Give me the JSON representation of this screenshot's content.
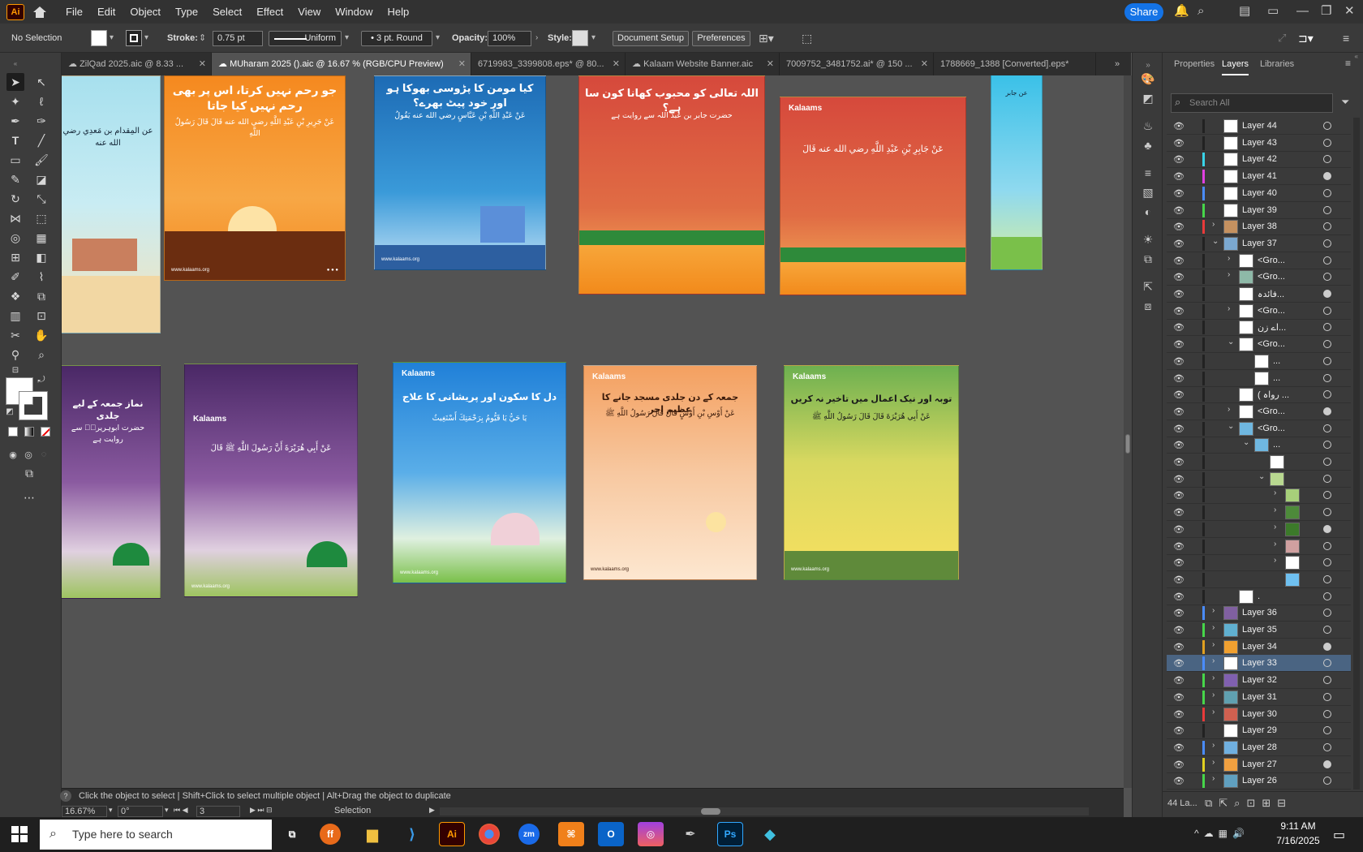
{
  "app": {
    "logo": "Ai",
    "menu": [
      "File",
      "Edit",
      "Object",
      "Type",
      "Select",
      "Effect",
      "View",
      "Window",
      "Help"
    ],
    "share": "Share"
  },
  "control": {
    "selection": "No Selection",
    "stroke_label": "Stroke:",
    "stroke_value": "0.75 pt",
    "profile": "Uniform",
    "brush": "3 pt. Round",
    "opacity_label": "Opacity:",
    "opacity_value": "100%",
    "style_label": "Style:",
    "document_setup": "Document Setup",
    "preferences": "Preferences"
  },
  "tabs": [
    {
      "label": "ZilQad 2025.aic @ 8.33 ...",
      "active": false
    },
    {
      "label": "MUharam 2025 ().aic @ 16.67 % (RGB/CPU Preview)",
      "active": true
    },
    {
      "label": "6719983_3399808.eps* @ 80...",
      "active": false
    },
    {
      "label": "Kalaam Website Banner.aic",
      "active": false
    },
    {
      "label": "7009752_3481752.ai* @ 150 ...",
      "active": false
    },
    {
      "label": "1788669_1388 [Converted].eps*",
      "active": false
    }
  ],
  "artboards": {
    "a2_title": "جو رحم نہیں کرتا، اس پر بھی رحم نہیں کیا جاتا",
    "a3_title": "کیا مومن کا پڑوسی بھوکا ہو اور خود پیٹ بھرے؟",
    "a4_title": "اللہ تعالی کو محبوب کھانا کون سا ہے؟",
    "a7_title": "نماز جمعہ کے لیے جلدی",
    "a9_title": "دل کا سکون اور پریشانی کا علاج",
    "a10_title": "جمعہ کے دن جلدی مسجد جانے کا عظیم اجر",
    "a11_title": "توبہ اور نیک اعمال میں تاخیر نہ کریں",
    "brand": "Kalaams",
    "url": "www.kalaams.org"
  },
  "status": {
    "hint": "Click the object to select  |  Shift+Click to select multiple object  |  Alt+Drag the object to duplicate",
    "zoom": "16.67%",
    "rotation": "0°",
    "artboard": "3",
    "mode": "Selection"
  },
  "panel": {
    "tabs": [
      "Properties",
      "Layers",
      "Libraries"
    ],
    "search_placeholder": "Search All",
    "layer_count": "44 La..."
  },
  "layers": [
    {
      "name": "Layer 44",
      "color": "#222",
      "expand": "",
      "depth": 0,
      "thumb": "#fff"
    },
    {
      "name": "Layer 43",
      "color": "#222",
      "expand": "",
      "depth": 0,
      "thumb": "#fff"
    },
    {
      "name": "Layer 42",
      "color": "#39d4e8",
      "expand": "",
      "depth": 0,
      "thumb": "#fff"
    },
    {
      "name": "Layer 41",
      "color": "#e040e0",
      "expand": "",
      "depth": 0,
      "thumb": "#fff"
    },
    {
      "name": "Layer 40",
      "color": "#4a8cff",
      "expand": "",
      "depth": 0,
      "thumb": "#fff"
    },
    {
      "name": "Layer 39",
      "color": "#46d64a",
      "expand": "",
      "depth": 0,
      "thumb": "#fff"
    },
    {
      "name": "Layer 38",
      "color": "#e83a3a",
      "expand": "›",
      "depth": 0,
      "thumb": "#c59160"
    },
    {
      "name": "Layer 37",
      "color": "#222",
      "expand": "⌄",
      "depth": 0,
      "thumb": "#7ba8d0"
    },
    {
      "name": "<Gro...",
      "color": "#222",
      "expand": "›",
      "depth": 1,
      "thumb": "#fff"
    },
    {
      "name": "<Gro...",
      "color": "#222",
      "expand": "›",
      "depth": 1,
      "thumb": "#8eb9a8"
    },
    {
      "name": "فائدہ...",
      "color": "#222",
      "expand": "",
      "depth": 1,
      "thumb": "#fff"
    },
    {
      "name": "<Gro...",
      "color": "#222",
      "expand": "›",
      "depth": 1,
      "thumb": "#fff"
    },
    {
      "name": "اے زن...",
      "color": "#222",
      "expand": "",
      "depth": 1,
      "thumb": "#fff"
    },
    {
      "name": "<Gro...",
      "color": "#222",
      "expand": "⌄",
      "depth": 1,
      "thumb": "#fff"
    },
    {
      "name": "...",
      "color": "#222",
      "expand": "",
      "depth": 2,
      "thumb": "#fff"
    },
    {
      "name": "...",
      "color": "#222",
      "expand": "",
      "depth": 2,
      "thumb": "#fff"
    },
    {
      "name": "( رواہ ...",
      "color": "#222",
      "expand": "",
      "depth": 1,
      "thumb": "#fff"
    },
    {
      "name": "<Gro...",
      "color": "#222",
      "expand": "›",
      "depth": 1,
      "thumb": "#fff"
    },
    {
      "name": "<Gro...",
      "color": "#222",
      "expand": "⌄",
      "depth": 1,
      "thumb": "#6fb7e0"
    },
    {
      "name": "...",
      "color": "#222",
      "expand": "⌄",
      "depth": 2,
      "thumb": "#6fb7e0"
    },
    {
      "name": "",
      "color": "#222",
      "expand": "",
      "depth": 3,
      "thumb": "#fff"
    },
    {
      "name": "",
      "color": "#222",
      "expand": "⌄",
      "depth": 3,
      "thumb": "#b8d890"
    },
    {
      "name": "",
      "color": "#222",
      "expand": "›",
      "depth": 4,
      "thumb": "#a7d07a"
    },
    {
      "name": "",
      "color": "#222",
      "expand": "›",
      "depth": 4,
      "thumb": "#4d8a3a"
    },
    {
      "name": "",
      "color": "#222",
      "expand": "›",
      "depth": 4,
      "thumb": "#3c7a2a"
    },
    {
      "name": "",
      "color": "#222",
      "expand": "›",
      "depth": 4,
      "thumb": "#d0a0a0"
    },
    {
      "name": "",
      "color": "#222",
      "expand": "›",
      "depth": 4,
      "thumb": "#fff"
    },
    {
      "name": "",
      "color": "#222",
      "expand": "",
      "depth": 4,
      "thumb": "#6fc0f0"
    },
    {
      "name": ".",
      "color": "#222",
      "expand": "",
      "depth": 1,
      "thumb": "#fff"
    },
    {
      "name": "Layer 36",
      "color": "#4a8cff",
      "expand": "›",
      "depth": 0,
      "thumb": "#8060a0"
    },
    {
      "name": "Layer 35",
      "color": "#46d64a",
      "expand": "›",
      "depth": 0,
      "thumb": "#60b0d0"
    },
    {
      "name": "Layer 34",
      "color": "#e0a020",
      "expand": "›",
      "depth": 0,
      "thumb": "#f0a030"
    },
    {
      "name": "Layer 33",
      "color": "#4a8cff",
      "expand": "›",
      "depth": 0,
      "thumb": "#fff",
      "selected": true
    },
    {
      "name": "Layer 32",
      "color": "#46d64a",
      "expand": "›",
      "depth": 0,
      "thumb": "#8060b0"
    },
    {
      "name": "Layer 31",
      "color": "#46d64a",
      "expand": "›",
      "depth": 0,
      "thumb": "#60a0b0"
    },
    {
      "name": "Layer 30",
      "color": "#e83a3a",
      "expand": "›",
      "depth": 0,
      "thumb": "#d06050"
    },
    {
      "name": "Layer 29",
      "color": "#222",
      "expand": "",
      "depth": 0,
      "thumb": "#fff"
    },
    {
      "name": "Layer 28",
      "color": "#4a8cff",
      "expand": "›",
      "depth": 0,
      "thumb": "#70b0e0"
    },
    {
      "name": "Layer 27",
      "color": "#e0d020",
      "expand": "›",
      "depth": 0,
      "thumb": "#f0a040"
    },
    {
      "name": "Layer 26",
      "color": "#46d64a",
      "expand": "›",
      "depth": 0,
      "thumb": "#60a0c0"
    }
  ],
  "taskbar": {
    "search": "Type here to search",
    "time": "9:11 AM",
    "date": "7/16/2025"
  }
}
